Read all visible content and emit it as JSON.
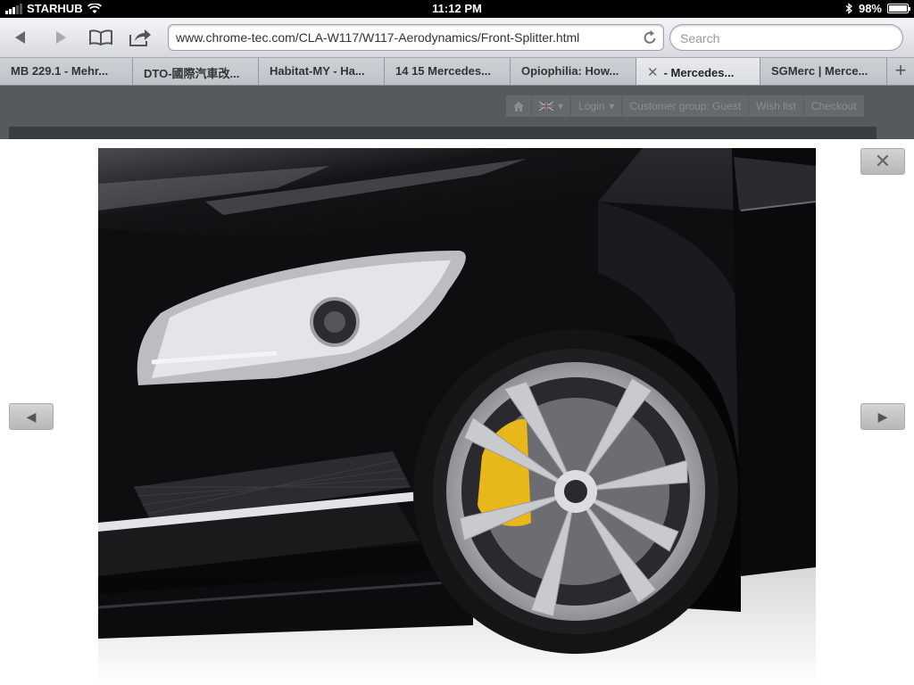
{
  "status_bar": {
    "carrier": "STARHUB",
    "time": "11:12 PM",
    "battery": "98%",
    "battery_level": 0.98
  },
  "toolbar": {
    "back_icon": "back-arrow-icon",
    "forward_icon": "forward-arrow-icon",
    "bookmarks_icon": "book-icon",
    "share_icon": "share-icon",
    "url": "www.chrome-tec.com/CLA-W117/W117-Aerodynamics/Front-Splitter.html",
    "search_placeholder": "Search"
  },
  "tabs": [
    {
      "label": "MB 229.1 - Mehr..."
    },
    {
      "label": "DTO-國際汽車改..."
    },
    {
      "label": "Habitat-MY - Ha..."
    },
    {
      "label": "14 15 Mercedes..."
    },
    {
      "label": "Opiophilia: How..."
    },
    {
      "label": "- Mercedes...",
      "active": true
    },
    {
      "label": "SGMerc | Merce..."
    }
  ],
  "page_header": {
    "login": "Login",
    "customer_group": "Customer group: Guest",
    "wish_list": "Wish list",
    "checkout": "Checkout"
  },
  "lightbox": {
    "close_label": "✕",
    "prev_label": "◀",
    "next_label": "▶"
  },
  "colors": {
    "brake_caliper": "#e8b81a",
    "car_paint": "#0d0d10"
  }
}
